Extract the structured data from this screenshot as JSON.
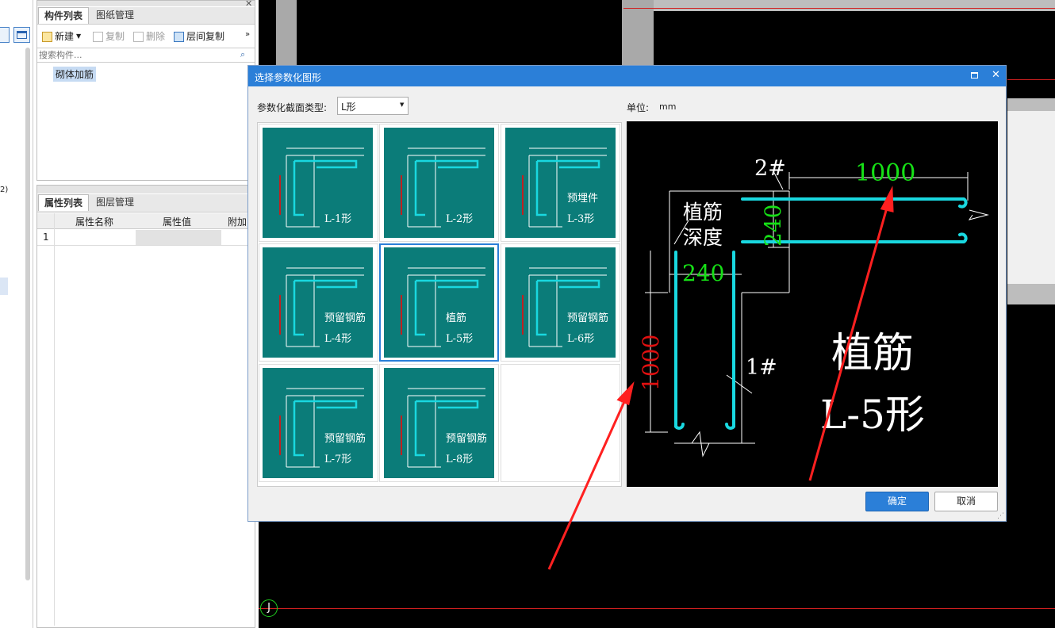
{
  "left_panel": {
    "tabs": [
      "构件列表",
      "图纸管理"
    ],
    "toolbar": {
      "new": "新建",
      "copy": "复制",
      "delete": "删除",
      "floor_copy": "层间复制"
    },
    "search_placeholder": "搜索构件...",
    "tree_item": "砌体加筋"
  },
  "props_panel": {
    "tabs": [
      "属性列表",
      "图层管理"
    ],
    "columns": [
      "属性名称",
      "属性值",
      "附加"
    ],
    "row_number": "1"
  },
  "far_left": {
    "fragment": "2)"
  },
  "dialog": {
    "title": "选择参数化图形",
    "type_label": "参数化截面类型:",
    "type_value": "L形",
    "unit_label": "单位:",
    "unit_value": "mm",
    "ok": "确定",
    "cancel": "取消",
    "thumbnails": [
      {
        "main": "",
        "name": "L-1形"
      },
      {
        "main": "",
        "name": "L-2形"
      },
      {
        "main": "预埋件",
        "name": "L-3形"
      },
      {
        "main": "预留钢筋",
        "name": "L-4形"
      },
      {
        "main": "植筋",
        "name": "L-5形"
      },
      {
        "main": "预留钢筋",
        "name": "L-6形"
      },
      {
        "main": "预留钢筋",
        "name": "L-7形"
      },
      {
        "main": "预留钢筋",
        "name": "L-8形"
      }
    ],
    "selected_index": 4,
    "preview": {
      "title_line1": "植筋",
      "title_line2": "L-5形",
      "depth_line1": "植筋",
      "depth_line2": "深度",
      "bar_top": "2#",
      "bar_vert": "1#",
      "dim_top": "1000",
      "dim_b2": "240",
      "dim_b1": "240",
      "dim_left": "1000"
    }
  },
  "canvas": {
    "axis_marker": "J"
  },
  "colors": {
    "teal": "#0b7c79",
    "cyan": "#19d8e0",
    "accent": "#2b7fd8",
    "dim_green": "#16e016",
    "dim_red": "#e01010",
    "arrow_red": "#ff2020"
  }
}
